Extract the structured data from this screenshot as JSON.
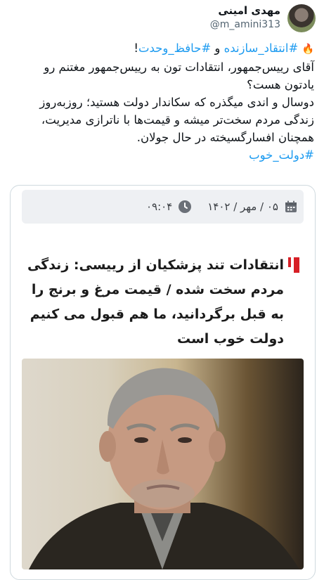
{
  "user": {
    "display_name": "مهدی امینی",
    "handle": "@m_amini313"
  },
  "tweet": {
    "hashtag1": "#انتقاد_سازنده",
    "connector": " و ",
    "hashtag2": "#حافظ_وحدت",
    "exclaim": "!",
    "line1": "آقای رییس‌جمهور، انتقادات تون به رییس‌جمهور مغتنم رو یادتون هست؟",
    "line2": "دوسال و اندی میگذره که سکاندار دولت هستید؛ روزبه‌روز زندگی مردم سخت‌تر میشه و قیمت‌ها با ناترازی مدیریت، همچنان افسارگسیخته در حال جولان.",
    "hashtag3": "#دولت_خوب"
  },
  "card": {
    "date": "۰۵ / مهر / ۱۴۰۲",
    "time": "۰۹:۰۴",
    "headline": "انتقادات تند پزشکیان از رییسی: زندگی مردم سخت شده / قیمت مرغ و برنج را به قبل برگردانید، ما هم قبول می کنیم دولت خوب است"
  },
  "icons": {
    "fire": "fire-icon",
    "calendar": "calendar-icon",
    "clock": "clock-icon"
  },
  "colors": {
    "hashtag": "#1d9bf0",
    "accent": "#d71f26",
    "date_bar_bg": "#eef0f3"
  }
}
